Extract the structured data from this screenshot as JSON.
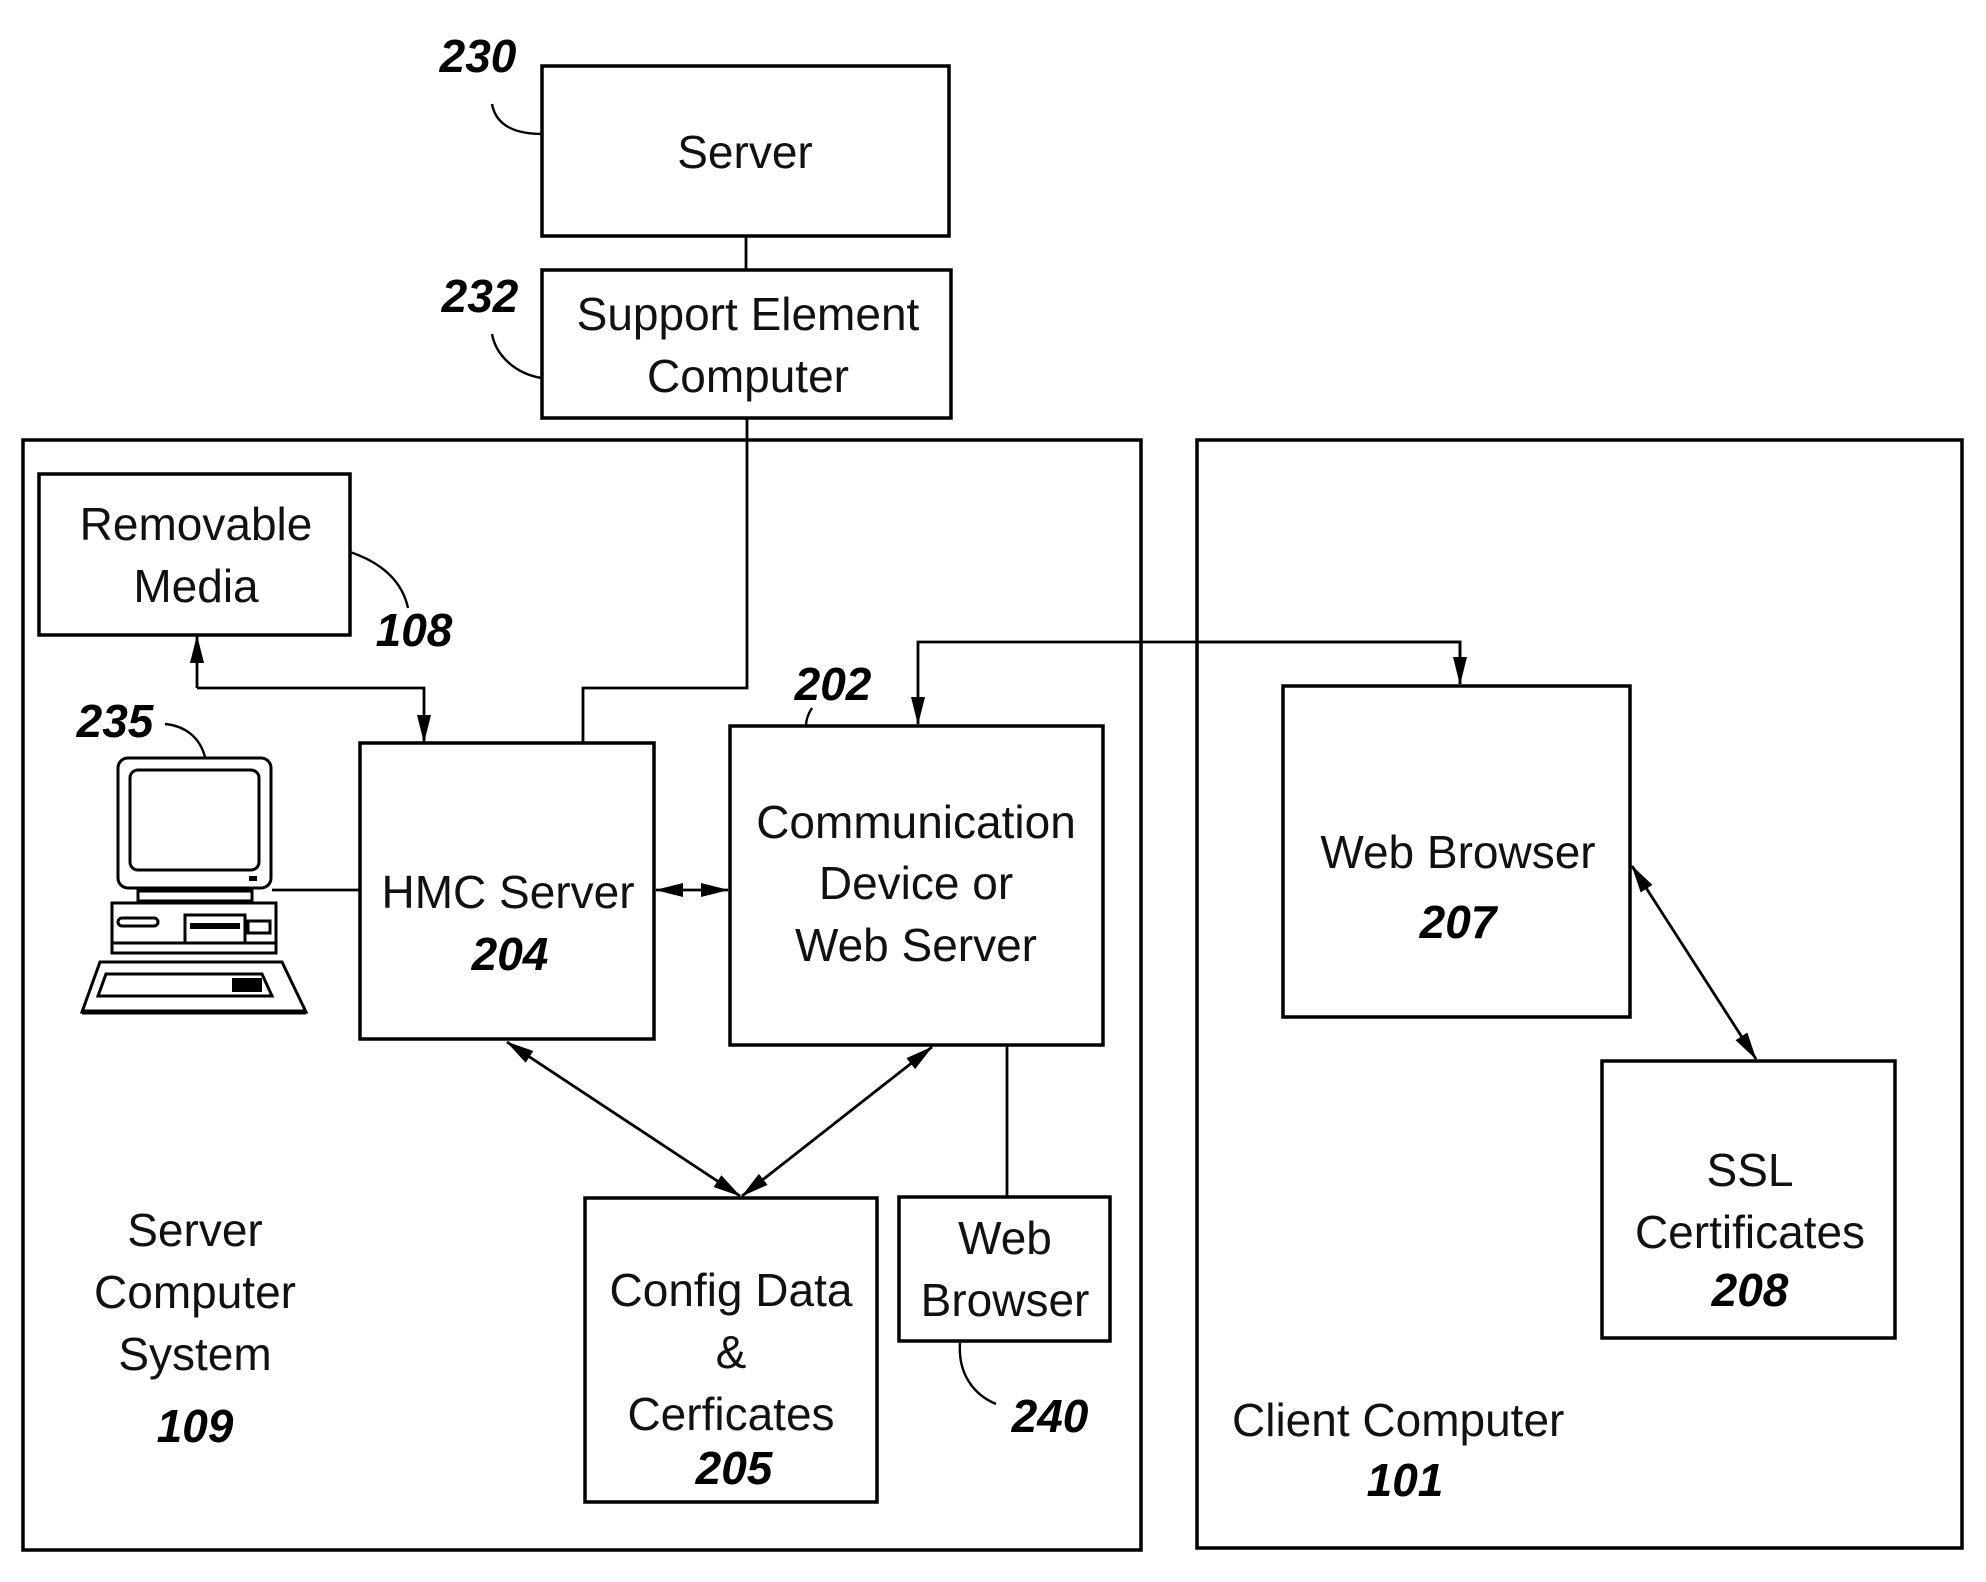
{
  "diagram": {
    "server": {
      "label": "Server",
      "ref": "230"
    },
    "support_element": {
      "line1": "Support Element",
      "line2": "Computer",
      "ref": "232"
    },
    "server_computer_system": {
      "line1": "Server",
      "line2": "Computer",
      "line3": "System",
      "ref": "109"
    },
    "removable_media": {
      "line1": "Removable",
      "line2": "Media",
      "ref": "108"
    },
    "console": {
      "icon": "desktop-computer-icon",
      "ref": "235"
    },
    "hmc_server": {
      "label": "HMC Server",
      "ref": "204"
    },
    "communication_device": {
      "line1": "Communication",
      "line2": "Device or",
      "line3": "Web Server",
      "ref": "202"
    },
    "config_data": {
      "line1": "Config Data",
      "line2": "&",
      "line3": "Cerficates",
      "ref": "205"
    },
    "local_web_browser": {
      "line1": "Web",
      "line2": "Browser",
      "ref": "240"
    },
    "client_computer": {
      "label": "Client Computer",
      "ref": "101"
    },
    "client_web_browser": {
      "label": "Web Browser",
      "ref": "207"
    },
    "ssl_certificates": {
      "line1": "SSL",
      "line2": "Certificates",
      "ref": "208"
    }
  },
  "colors": {
    "stroke": "#000000",
    "background": "#ffffff"
  }
}
